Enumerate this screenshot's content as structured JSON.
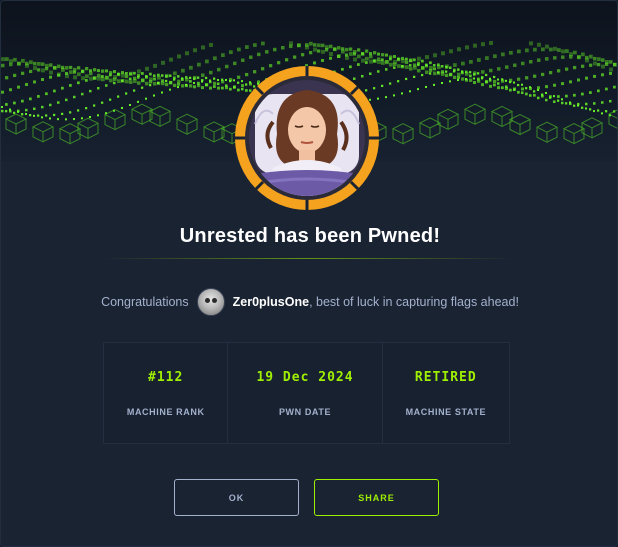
{
  "dialog": {
    "title": "Unrested has been Pwned!",
    "machine_name": "Unrested"
  },
  "congrats": {
    "prefix": "Congratulations",
    "username": "Zer0plusOne",
    "suffix": ", best of luck in capturing flags ahead!"
  },
  "stats": [
    {
      "value": "#112",
      "label": "MACHINE RANK"
    },
    {
      "value": "19 Dec 2024",
      "label": "PWN DATE"
    },
    {
      "value": "RETIRED",
      "label": "MACHINE STATE"
    }
  ],
  "buttons": {
    "ok": "OK",
    "share": "SHARE"
  },
  "colors": {
    "background": "#1a2332",
    "accent_green": "#9fef00",
    "ring_orange": "#f5a21e",
    "text_muted": "#a4b1cd"
  },
  "icons": {
    "machine_avatar": "woman-in-bed-avatar",
    "user_avatar": "user-avatar"
  }
}
